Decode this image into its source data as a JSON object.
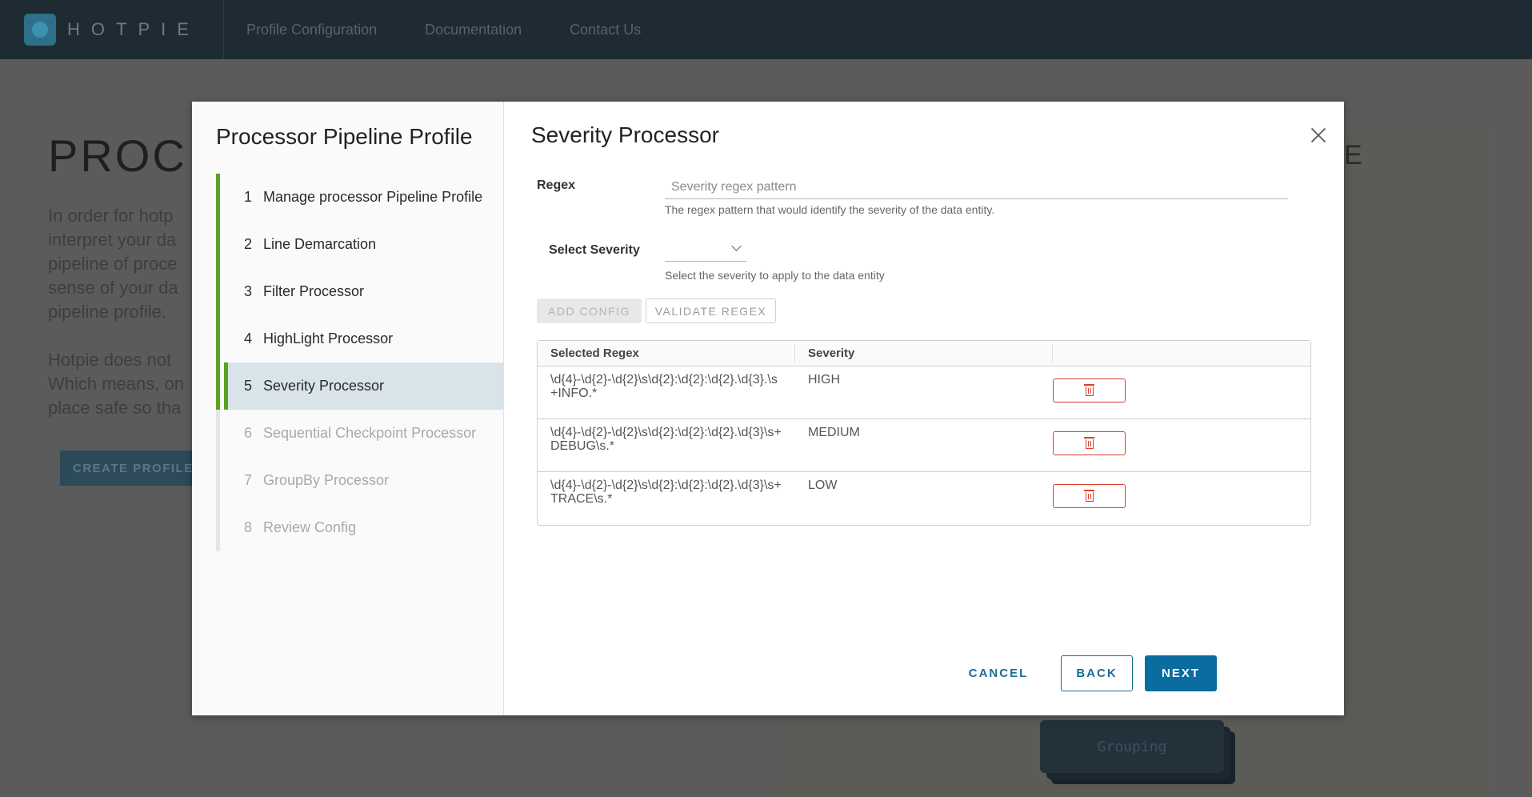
{
  "app": {
    "brand": "HOTPIE",
    "nav": [
      "Profile Configuration",
      "Documentation",
      "Contact Us"
    ]
  },
  "background": {
    "title": "PROC",
    "para1": "In order for hotp interpret your da pipeline of proce sense of your da pipeline profile.",
    "para2": "Hotpie does not Which means, on place safe so tha",
    "create_button": "CREATE PROFILE",
    "panel_letter": "E",
    "group_card": "Grouping"
  },
  "modal": {
    "wizard_title": "Processor Pipeline Profile",
    "steps": [
      {
        "num": "1",
        "label": "Manage processor Pipeline Profile",
        "state": "done"
      },
      {
        "num": "2",
        "label": "Line Demarcation",
        "state": "done"
      },
      {
        "num": "3",
        "label": "Filter Processor",
        "state": "done"
      },
      {
        "num": "4",
        "label": "HighLight Processor",
        "state": "done"
      },
      {
        "num": "5",
        "label": "Severity Processor",
        "state": "active"
      },
      {
        "num": "6",
        "label": "Sequential Checkpoint Processor",
        "state": "pending"
      },
      {
        "num": "7",
        "label": "GroupBy Processor",
        "state": "pending"
      },
      {
        "num": "8",
        "label": "Review Config",
        "state": "pending"
      }
    ],
    "title": "Severity Processor",
    "form": {
      "regex_label": "Regex",
      "regex_placeholder": "Severity regex pattern",
      "regex_value": "",
      "regex_helper": "The regex pattern that would identify the severity of the data entity.",
      "severity_label": "Select Severity",
      "severity_value": "",
      "severity_helper": "Select the severity to apply to the data entity",
      "add_config": "ADD CONFIG",
      "validate_regex": "VALIDATE REGEX"
    },
    "table": {
      "headers": [
        "Selected Regex",
        "Severity",
        ""
      ],
      "rows": [
        {
          "regex": "\\d{4}-\\d{2}-\\d{2}\\s\\d{2}:\\d{2}:\\d{2}.\\d{3}.\\s+INFO.*",
          "severity": "HIGH"
        },
        {
          "regex": "\\d{4}-\\d{2}-\\d{2}\\s\\d{2}:\\d{2}:\\d{2}.\\d{3}\\s+DEBUG\\s.*",
          "severity": "MEDIUM"
        },
        {
          "regex": "\\d{4}-\\d{2}-\\d{2}\\s\\d{2}:\\d{2}:\\d{2}.\\d{3}\\s+TRACE\\s.*",
          "severity": "LOW"
        }
      ]
    },
    "footer": {
      "cancel": "CANCEL",
      "back": "BACK",
      "next": "NEXT"
    }
  },
  "colors": {
    "topbar": "#1e2b33",
    "accent": "#0b6ca0",
    "step_done": "#5aa220",
    "danger": "#d6402a"
  }
}
